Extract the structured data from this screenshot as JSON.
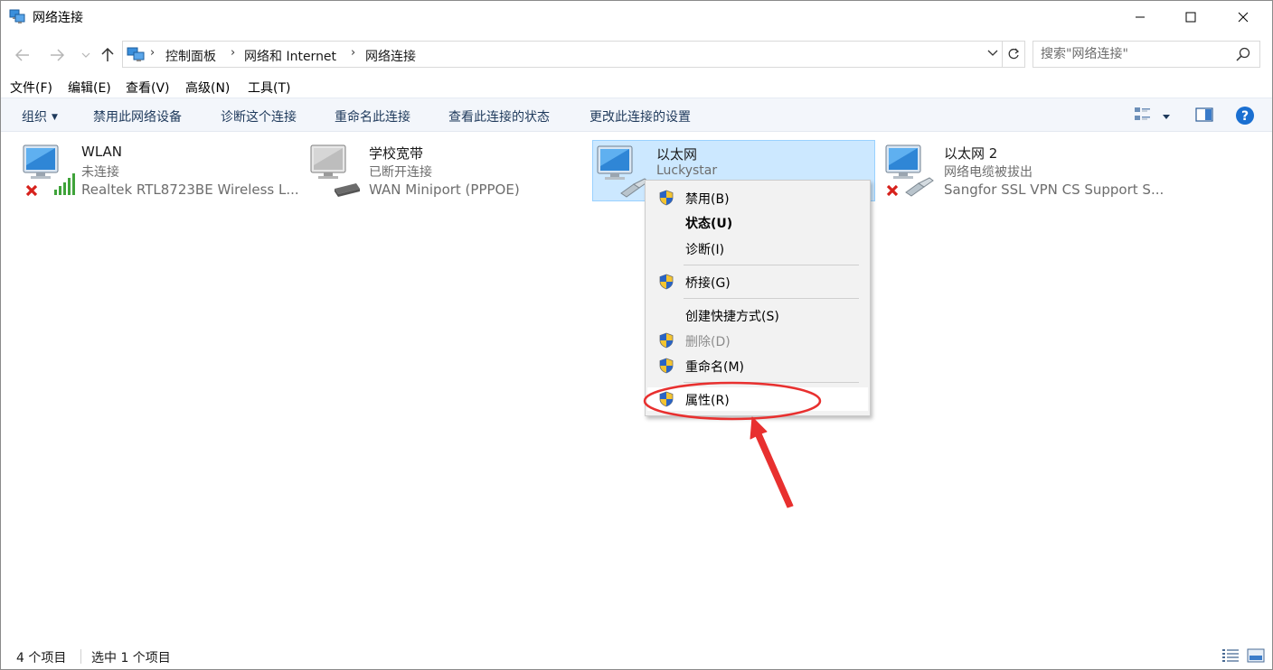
{
  "window": {
    "title": "网络连接"
  },
  "address": {
    "crumbs": [
      "控制面板",
      "网络和 Internet",
      "网络连接"
    ],
    "search_placeholder": "搜索\"网络连接\""
  },
  "menu": {
    "items": [
      "文件(F)",
      "编辑(E)",
      "查看(V)",
      "高级(N)",
      "工具(T)"
    ]
  },
  "commands": {
    "organize": "组织",
    "disable": "禁用此网络设备",
    "diagnose": "诊断这个连接",
    "rename": "重命名此连接",
    "view_status": "查看此连接的状态",
    "change_settings": "更改此连接的设置"
  },
  "connections": [
    {
      "name": "WLAN",
      "status": "未连接",
      "device": "Realtek RTL8723BE Wireless L..."
    },
    {
      "name": "学校宽带",
      "status": "已断开连接",
      "device": "WAN Miniport (PPPOE)"
    },
    {
      "name": "以太网",
      "status": "Luckystar",
      "device": ""
    },
    {
      "name": "以太网 2",
      "status": "网络电缆被拔出",
      "device": "Sangfor SSL VPN CS Support S..."
    }
  ],
  "context_menu": {
    "items": [
      {
        "label": "禁用(B)",
        "shield": true,
        "bold": false,
        "disabled": false
      },
      {
        "label": "状态(U)",
        "shield": false,
        "bold": true,
        "disabled": false
      },
      {
        "label": "诊断(I)",
        "shield": false,
        "bold": false,
        "disabled": false
      },
      {
        "label": "桥接(G)",
        "shield": true,
        "bold": false,
        "disabled": false
      },
      {
        "label": "创建快捷方式(S)",
        "shield": false,
        "bold": false,
        "disabled": false
      },
      {
        "label": "删除(D)",
        "shield": true,
        "bold": false,
        "disabled": true
      },
      {
        "label": "重命名(M)",
        "shield": true,
        "bold": false,
        "disabled": false
      },
      {
        "label": "属性(R)",
        "shield": true,
        "bold": false,
        "disabled": false
      }
    ]
  },
  "statusbar": {
    "count": "4 个项目",
    "selected": "选中 1 个项目"
  },
  "colors": {
    "command_text": "#1e395b",
    "selection_bg": "#cce8ff",
    "annotation_red": "#e8302f",
    "help_blue": "#1a6fd1"
  }
}
